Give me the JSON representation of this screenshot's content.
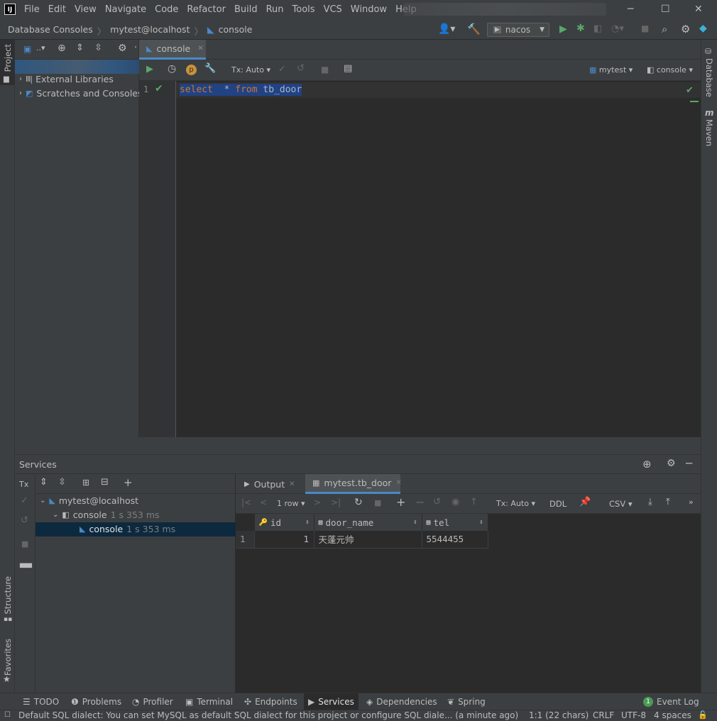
{
  "app": {
    "logo": "IJ"
  },
  "menu": [
    "File",
    "Edit",
    "View",
    "Navigate",
    "Code",
    "Refactor",
    "Build",
    "Run",
    "Tools",
    "VCS",
    "Window",
    "Help"
  ],
  "breadcrumb": {
    "root": "Database Consoles",
    "datasource": "mytest@localhost",
    "file": "console"
  },
  "run_config": "nacos",
  "project_panel": {
    "items": [
      "External Libraries",
      "Scratches and Consoles"
    ]
  },
  "left_strip": {
    "project": "Project",
    "structure": "Structure",
    "favorites": "Favorites"
  },
  "right_strip": {
    "database": "Database",
    "maven": "Maven"
  },
  "editor": {
    "tab": "console",
    "tx_mode": "Tx: Auto",
    "schema": "mytest",
    "session": "console",
    "line_number": "1",
    "code": {
      "select": "select",
      "star": "*",
      "from": "from",
      "table": "tb_door"
    }
  },
  "services": {
    "title": "Services",
    "tree": {
      "root": "mytest@localhost",
      "session": "console",
      "session_time": "1 s 353 ms",
      "console": "console",
      "console_time": "1 s 353 ms"
    },
    "result_tabs": {
      "output": "Output",
      "table": "mytest.tb_door"
    },
    "toolbar": {
      "rows": "1 row",
      "tx_mode": "Tx: Auto",
      "ddl": "DDL",
      "export": "CSV"
    },
    "grid": {
      "columns": [
        "id",
        "door_name",
        "tel"
      ],
      "rows": [
        {
          "num": "1",
          "id": "1",
          "door_name": "天蓬元帅",
          "tel": "5544455"
        }
      ]
    }
  },
  "tool_windows": {
    "todo": "TODO",
    "problems": "Problems",
    "profiler": "Profiler",
    "terminal": "Terminal",
    "endpoints": "Endpoints",
    "services": "Services",
    "dependencies": "Dependencies",
    "spring": "Spring",
    "event_log": "Event Log",
    "event_count": "1"
  },
  "status": {
    "message": "Default SQL dialect: You can set MySQL as default SQL dialect for this project or configure SQL diale... (a minute ago)",
    "position": "1:1 (22 chars)",
    "line_sep": "CRLF",
    "encoding": "UTF-8",
    "indent": "4 spaces"
  },
  "colors": {
    "accent": "#4a88c7",
    "keyword": "#cc7832",
    "run": "#59a869",
    "selection": "#214283"
  }
}
